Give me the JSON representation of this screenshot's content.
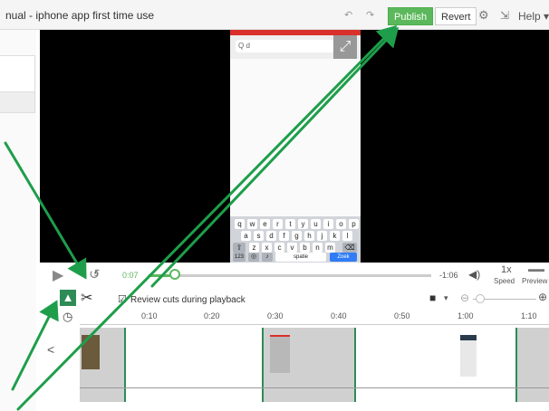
{
  "titlebar": {
    "title": "nual - iphone app first time use",
    "publish_label": "Publish",
    "revert_label": "Revert",
    "help_label": "Help",
    "icons": [
      "undo-icon",
      "redo-icon",
      "gear-icon",
      "export-icon"
    ]
  },
  "phone": {
    "search_text": "Q d",
    "keyboard_rows": [
      [
        "q",
        "w",
        "e",
        "r",
        "t",
        "y",
        "u",
        "i",
        "o",
        "p"
      ],
      [
        "a",
        "s",
        "d",
        "f",
        "g",
        "h",
        "j",
        "k",
        "l"
      ],
      [
        "z",
        "x",
        "c",
        "v",
        "b",
        "n",
        "m"
      ]
    ],
    "bottom_keys": [
      "123",
      "spatie",
      "Zoek"
    ]
  },
  "controls": {
    "rewind_label": "5",
    "current_time": "0:07",
    "remaining_time": "-1:06",
    "speed_value": "1x",
    "speed_label": "Speed",
    "preview_label": "Preview",
    "progress": 0.1
  },
  "tools": {
    "review_cuts_label": "Review cuts during playback",
    "review_checked": true
  },
  "timeline": {
    "ticks": [
      "0:10",
      "0:20",
      "0:30",
      "0:40",
      "0:50",
      "1:00",
      "1:10"
    ],
    "nav_left": "<"
  },
  "colors": {
    "accent": "#5cb85c",
    "arrow": "#1e9e4a",
    "video_bg": "#000000"
  }
}
